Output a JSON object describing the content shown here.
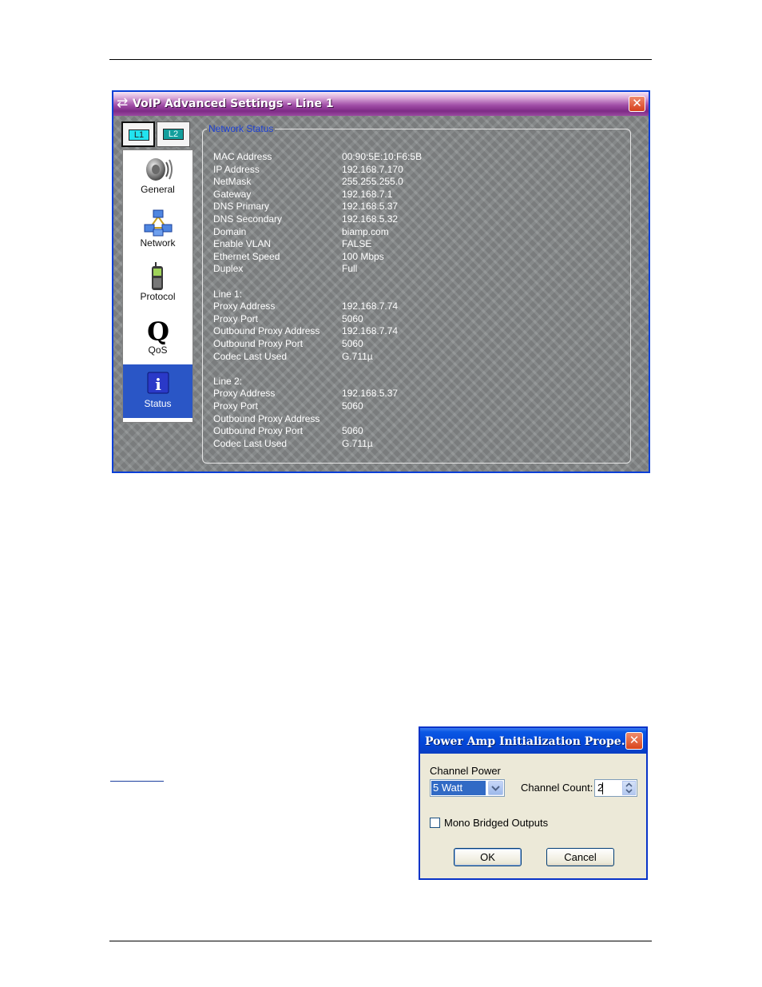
{
  "voip_window": {
    "title": "VoIP Advanced Settings - Line 1",
    "title_icon": "⇄",
    "close_glyph": "✕",
    "line_tabs": [
      "L1",
      "L2"
    ],
    "nav": [
      {
        "label": "General",
        "icon": "speaker-icon"
      },
      {
        "label": "Network",
        "icon": "network-icon"
      },
      {
        "label": "Protocol",
        "icon": "phone-icon"
      },
      {
        "label": "QoS",
        "icon": "qos-icon"
      },
      {
        "label": "Status",
        "icon": "info-icon",
        "active": true
      }
    ],
    "qos_glyph": "Q",
    "info_glyph": "i",
    "network_status": {
      "legend": "Network Status",
      "rows": [
        {
          "key": "MAC Address",
          "value": "00:90:5E:10:F6:5B"
        },
        {
          "key": "IP Address",
          "value": "192.168.7.170"
        },
        {
          "key": "NetMask",
          "value": "255.255.255.0"
        },
        {
          "key": "Gateway",
          "value": "192.168.7.1"
        },
        {
          "key": "DNS Primary",
          "value": "192.168.5.37"
        },
        {
          "key": "DNS Secondary",
          "value": "192.168.5.32"
        },
        {
          "key": "Domain",
          "value": "biamp.com"
        },
        {
          "key": "Enable VLAN",
          "value": "FALSE"
        },
        {
          "key": "Ethernet Speed",
          "value": "100 Mbps"
        },
        {
          "key": "Duplex",
          "value": "Full"
        },
        {
          "key": "",
          "value": ""
        },
        {
          "key": "Line 1:",
          "value": ""
        },
        {
          "key": "Proxy Address",
          "value": "192.168.7.74"
        },
        {
          "key": "Proxy Port",
          "value": "5060"
        },
        {
          "key": "Outbound Proxy Address",
          "value": "192.168.7.74"
        },
        {
          "key": "Outbound Proxy Port",
          "value": "5060"
        },
        {
          "key": "Codec Last Used",
          "value": "G.711µ"
        },
        {
          "key": "",
          "value": ""
        },
        {
          "key": "Line 2:",
          "value": ""
        },
        {
          "key": "Proxy Address",
          "value": "192.168.5.37"
        },
        {
          "key": "Proxy Port",
          "value": "5060"
        },
        {
          "key": "Outbound Proxy Address",
          "value": ""
        },
        {
          "key": "Outbound Proxy Port",
          "value": "5060"
        },
        {
          "key": "Codec Last Used",
          "value": "G.711µ"
        }
      ]
    }
  },
  "amp_dialog": {
    "title": "Power Amp Initialization Prope…",
    "close_glyph": "✕",
    "channel_power_label": "Channel Power",
    "channel_power_value": "5 Watt",
    "channel_count_label": "Channel Count:",
    "channel_count_value": "2",
    "mono_bridged_label": "Mono Bridged Outputs",
    "mono_bridged_checked": false,
    "ok_label": "OK",
    "cancel_label": "Cancel"
  }
}
